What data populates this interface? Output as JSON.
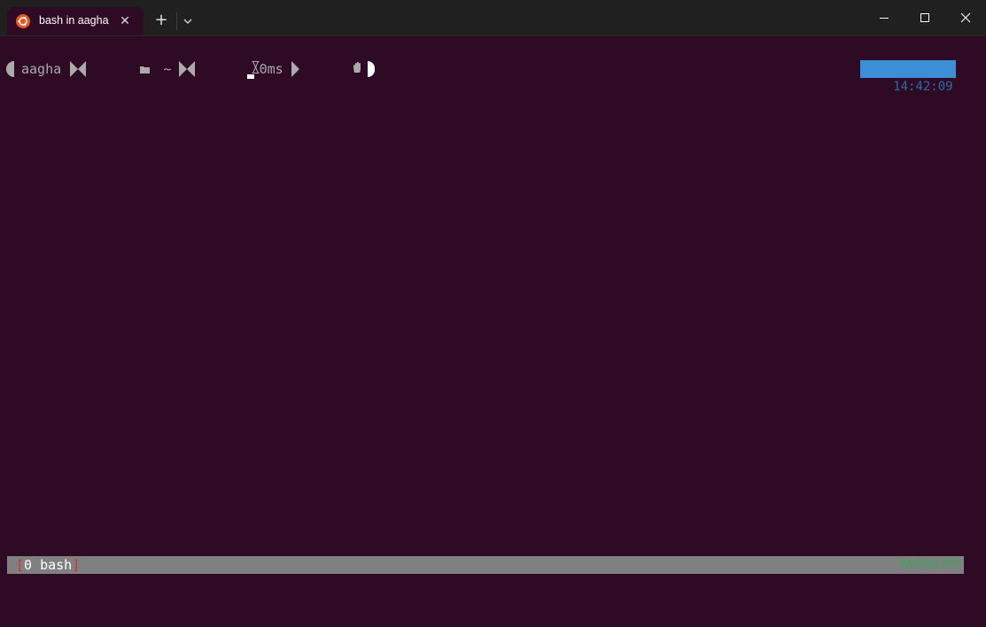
{
  "window": {
    "tab_title": "bash in aagha",
    "tab_icon": "ubuntu-icon",
    "close_tab_glyph": "✕",
    "new_tab_glyph": "+",
    "dropdown_icon": "chevron-down-icon"
  },
  "prompt": {
    "user": "aagha",
    "folder_icon": "folder-icon",
    "path": "~",
    "timer_icon": "hourglass-icon",
    "duration": "0ms",
    "hand_icon": "hand-icon"
  },
  "clock": {
    "time": "14:42:09"
  },
  "statusbar": {
    "open_bracket": "[",
    "window": "0 bash",
    "close_bracket": "]",
    "host": "AAGHALAPS"
  },
  "colors": {
    "terminal_bg": "#2e0a24",
    "titlebar_bg": "#202020",
    "prompt_fg": "#aaaaaa",
    "clock_bg": "#3c8fd7",
    "status_bg": "#808080",
    "status_bracket": "#d03030",
    "status_host": "#3aa65a",
    "ubuntu_orange": "#e95420"
  }
}
